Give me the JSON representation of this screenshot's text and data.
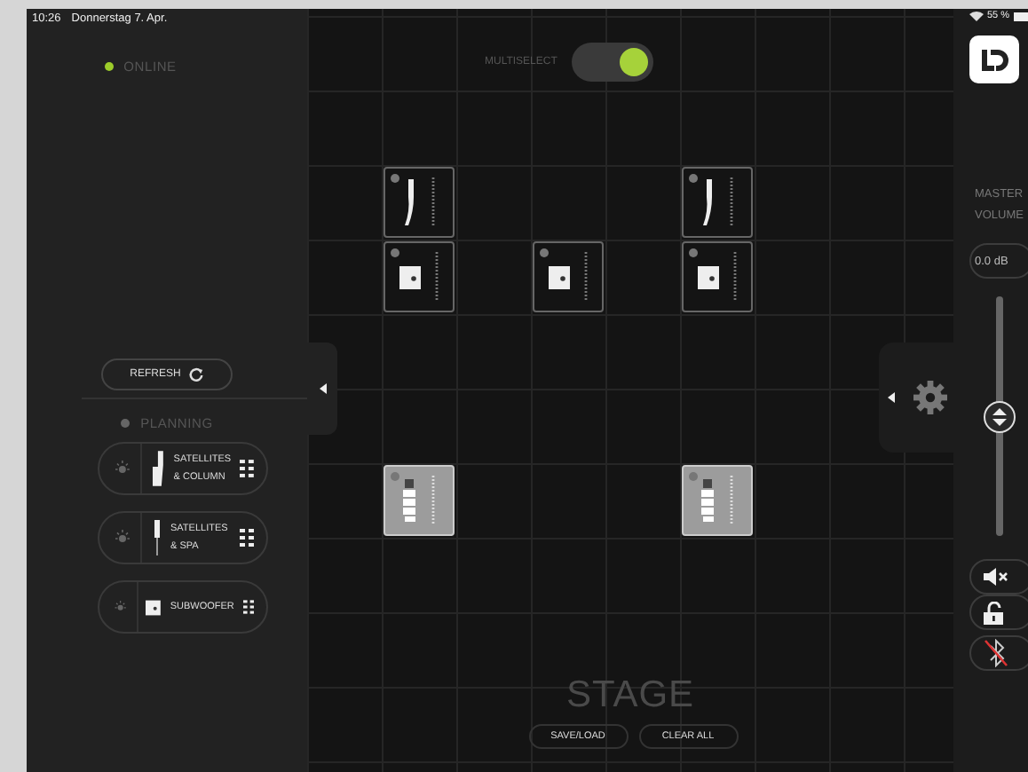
{
  "status_bar": {
    "time": "10:26",
    "date": "Donnerstag 7. Apr.",
    "battery": "55 %"
  },
  "connection": {
    "label": "ONLINE",
    "online": true
  },
  "multiselect": {
    "label": "MULTISELECT",
    "on": true
  },
  "refresh_button": "REFRESH",
  "planning": {
    "label": "PLANNING",
    "active": false
  },
  "device_list": [
    {
      "kind": "column",
      "label": "SATELLITES & COLUMN"
    },
    {
      "kind": "spa",
      "label": "SATELLITES & SPA"
    },
    {
      "kind": "subwoofer",
      "label": "SUBWOOFER"
    }
  ],
  "stage": {
    "title": "STAGE",
    "devices": [
      {
        "kind": "satellite",
        "selected": false
      },
      {
        "kind": "satellite",
        "selected": false
      },
      {
        "kind": "subwoofer",
        "selected": false
      },
      {
        "kind": "subwoofer",
        "selected": false
      },
      {
        "kind": "subwoofer",
        "selected": false
      },
      {
        "kind": "array",
        "selected": true
      },
      {
        "kind": "array",
        "selected": true
      }
    ],
    "buttons": [
      "SAVE/LOAD",
      "CLEAR ALL"
    ]
  },
  "master_volume": {
    "label": "MASTER VOLUME",
    "reading": "0.0 dB",
    "level": 0.5
  }
}
